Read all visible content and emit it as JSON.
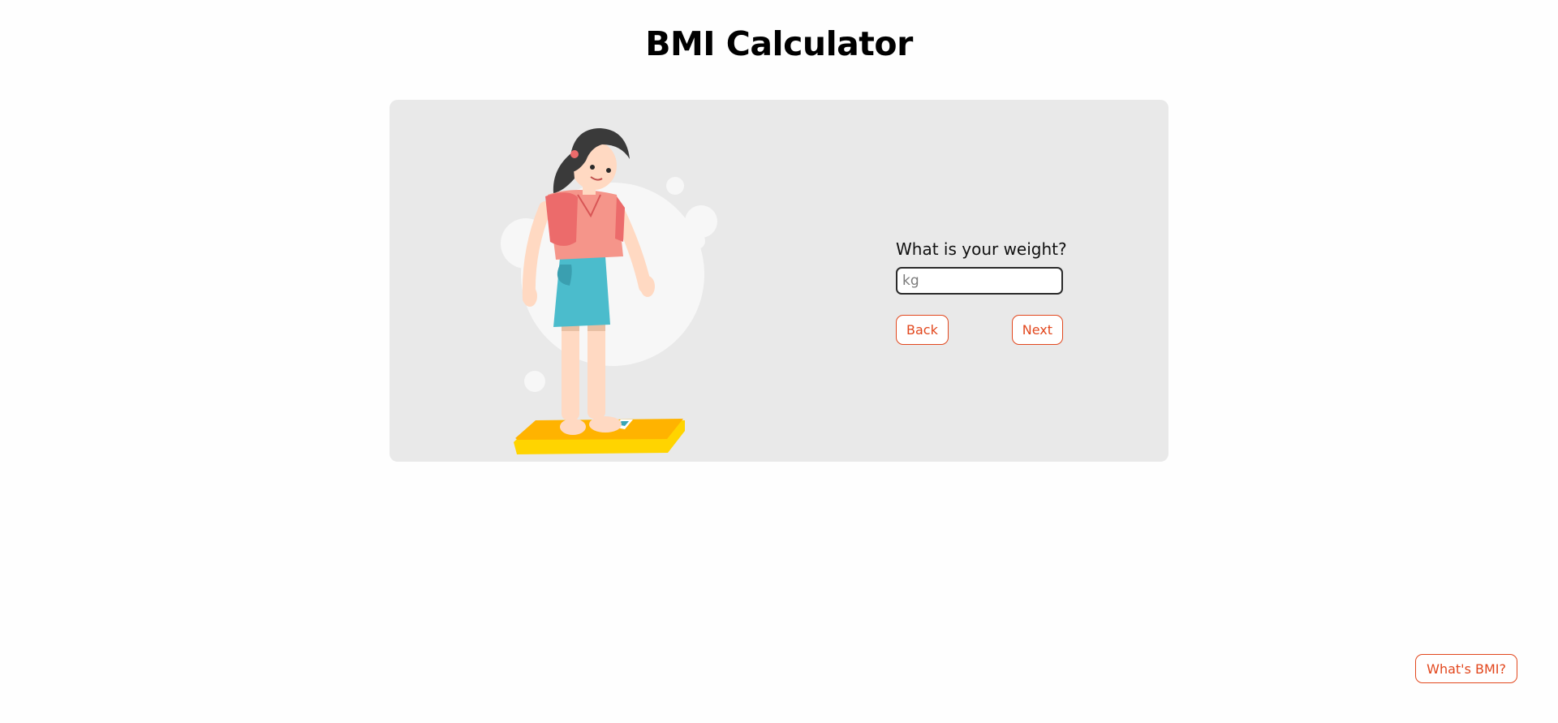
{
  "header": {
    "title": "BMI Calculator"
  },
  "form": {
    "question": "What is your weight?",
    "weight_input": {
      "value": "",
      "placeholder": "kg"
    },
    "back_label": "Back",
    "next_label": "Next"
  },
  "help": {
    "whats_bmi_label": "What's BMI?"
  },
  "illustration": {
    "name": "person-on-scale-illustration"
  },
  "colors": {
    "accent": "#e2471d",
    "card_background": "#e9e9e9",
    "page_background": "#fefefe"
  }
}
